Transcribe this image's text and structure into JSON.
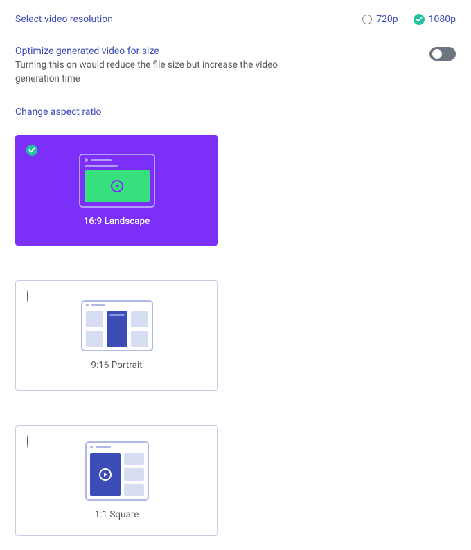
{
  "resolution": {
    "label": "Select video resolution",
    "options": [
      {
        "label": "720p",
        "selected": false
      },
      {
        "label": "1080p",
        "selected": true
      }
    ]
  },
  "optimize": {
    "label": "Optimize generated video for size",
    "description": "Turning this on would reduce the file size but increase the video generation time",
    "enabled": false
  },
  "aspect": {
    "label": "Change aspect ratio",
    "options": [
      {
        "label": "16:9 Landscape",
        "selected": true
      },
      {
        "label": "9:16 Portrait",
        "selected": false
      },
      {
        "label": "1:1 Square",
        "selected": false
      }
    ]
  }
}
